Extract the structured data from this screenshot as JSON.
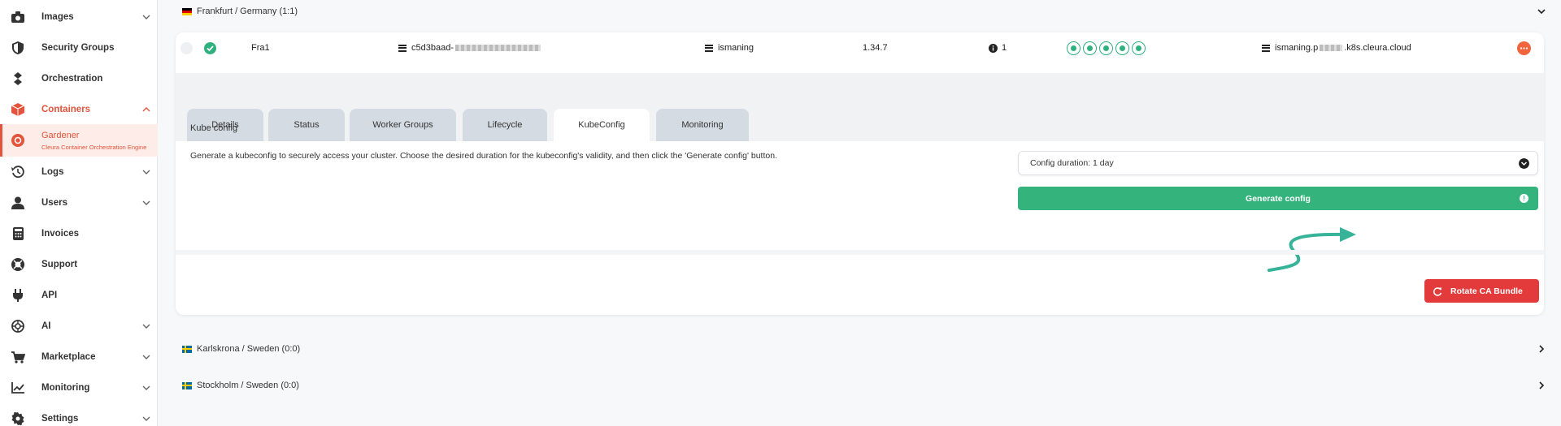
{
  "sidebar": {
    "items": [
      {
        "label": "Images",
        "icon": "camera-icon",
        "chevron": true
      },
      {
        "label": "Security Groups",
        "icon": "shield-icon",
        "chevron": false
      },
      {
        "label": "Orchestration",
        "icon": "orchestration-icon",
        "chevron": false
      },
      {
        "label": "Containers",
        "icon": "cube-icon",
        "chevron": true
      },
      {
        "label": "Gardener",
        "sublabel": "Cleura Container Orchestration Engine",
        "icon": "gardener-icon"
      },
      {
        "label": "Logs",
        "icon": "history-icon",
        "chevron": true
      },
      {
        "label": "Users",
        "icon": "user-icon",
        "chevron": true
      },
      {
        "label": "Invoices",
        "icon": "calculator-icon",
        "chevron": false
      },
      {
        "label": "Support",
        "icon": "lifebuoy-icon",
        "chevron": false
      },
      {
        "label": "API",
        "icon": "plug-icon",
        "chevron": false
      },
      {
        "label": "AI",
        "icon": "ai-icon",
        "chevron": true
      },
      {
        "label": "Marketplace",
        "icon": "cart-icon",
        "chevron": true
      },
      {
        "label": "Monitoring",
        "icon": "chart-icon",
        "chevron": true
      },
      {
        "label": "Settings",
        "icon": "gear-icon",
        "chevron": true
      }
    ]
  },
  "regions": {
    "frankfurt": "Frankfurt / Germany (1:1)",
    "karlskrona": "Karlskrona / Sweden (0:0)",
    "stockholm": "Stockholm / Sweden (0:0)"
  },
  "cluster": {
    "name": "Fra1",
    "id_prefix": "c5d3baad-",
    "project": "ismaning",
    "version": "1.34.7",
    "info_count": "1",
    "domain_prefix": "ismaning.p",
    "domain_suffix": ".k8s.cleura.cloud"
  },
  "tabs": [
    {
      "label": "Details"
    },
    {
      "label": "Status"
    },
    {
      "label": "Worker Groups"
    },
    {
      "label": "Lifecycle"
    },
    {
      "label": "KubeConfig"
    },
    {
      "label": "Monitoring"
    }
  ],
  "kubeconfig": {
    "title": "Kube config",
    "description": "Generate a kubeconfig to securely access your cluster. Choose the desired duration for the kubeconfig's validity, and then click the 'Generate config' button.",
    "duration_select": "Config duration: 1 day",
    "generate_button": "Generate config",
    "rotate_button": "Rotate CA Bundle"
  },
  "colors": {
    "accent": "#e2543b",
    "success": "#35b37d",
    "danger": "#e33b3b"
  }
}
